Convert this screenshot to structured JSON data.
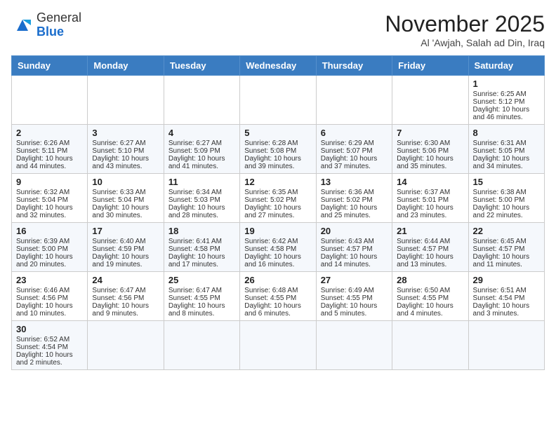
{
  "header": {
    "logo_line1": "General",
    "logo_line2": "Blue",
    "month_title": "November 2025",
    "location": "Al 'Awjah, Salah ad Din, Iraq"
  },
  "weekdays": [
    "Sunday",
    "Monday",
    "Tuesday",
    "Wednesday",
    "Thursday",
    "Friday",
    "Saturday"
  ],
  "weeks": [
    [
      {
        "day": "",
        "info": ""
      },
      {
        "day": "",
        "info": ""
      },
      {
        "day": "",
        "info": ""
      },
      {
        "day": "",
        "info": ""
      },
      {
        "day": "",
        "info": ""
      },
      {
        "day": "",
        "info": ""
      },
      {
        "day": "1",
        "info": "Sunrise: 6:25 AM\nSunset: 5:12 PM\nDaylight: 10 hours and 46 minutes."
      }
    ],
    [
      {
        "day": "2",
        "info": "Sunrise: 6:26 AM\nSunset: 5:11 PM\nDaylight: 10 hours and 44 minutes."
      },
      {
        "day": "3",
        "info": "Sunrise: 6:27 AM\nSunset: 5:10 PM\nDaylight: 10 hours and 43 minutes."
      },
      {
        "day": "4",
        "info": "Sunrise: 6:27 AM\nSunset: 5:09 PM\nDaylight: 10 hours and 41 minutes."
      },
      {
        "day": "5",
        "info": "Sunrise: 6:28 AM\nSunset: 5:08 PM\nDaylight: 10 hours and 39 minutes."
      },
      {
        "day": "6",
        "info": "Sunrise: 6:29 AM\nSunset: 5:07 PM\nDaylight: 10 hours and 37 minutes."
      },
      {
        "day": "7",
        "info": "Sunrise: 6:30 AM\nSunset: 5:06 PM\nDaylight: 10 hours and 35 minutes."
      },
      {
        "day": "8",
        "info": "Sunrise: 6:31 AM\nSunset: 5:05 PM\nDaylight: 10 hours and 34 minutes."
      }
    ],
    [
      {
        "day": "9",
        "info": "Sunrise: 6:32 AM\nSunset: 5:04 PM\nDaylight: 10 hours and 32 minutes."
      },
      {
        "day": "10",
        "info": "Sunrise: 6:33 AM\nSunset: 5:04 PM\nDaylight: 10 hours and 30 minutes."
      },
      {
        "day": "11",
        "info": "Sunrise: 6:34 AM\nSunset: 5:03 PM\nDaylight: 10 hours and 28 minutes."
      },
      {
        "day": "12",
        "info": "Sunrise: 6:35 AM\nSunset: 5:02 PM\nDaylight: 10 hours and 27 minutes."
      },
      {
        "day": "13",
        "info": "Sunrise: 6:36 AM\nSunset: 5:02 PM\nDaylight: 10 hours and 25 minutes."
      },
      {
        "day": "14",
        "info": "Sunrise: 6:37 AM\nSunset: 5:01 PM\nDaylight: 10 hours and 23 minutes."
      },
      {
        "day": "15",
        "info": "Sunrise: 6:38 AM\nSunset: 5:00 PM\nDaylight: 10 hours and 22 minutes."
      }
    ],
    [
      {
        "day": "16",
        "info": "Sunrise: 6:39 AM\nSunset: 5:00 PM\nDaylight: 10 hours and 20 minutes."
      },
      {
        "day": "17",
        "info": "Sunrise: 6:40 AM\nSunset: 4:59 PM\nDaylight: 10 hours and 19 minutes."
      },
      {
        "day": "18",
        "info": "Sunrise: 6:41 AM\nSunset: 4:58 PM\nDaylight: 10 hours and 17 minutes."
      },
      {
        "day": "19",
        "info": "Sunrise: 6:42 AM\nSunset: 4:58 PM\nDaylight: 10 hours and 16 minutes."
      },
      {
        "day": "20",
        "info": "Sunrise: 6:43 AM\nSunset: 4:57 PM\nDaylight: 10 hours and 14 minutes."
      },
      {
        "day": "21",
        "info": "Sunrise: 6:44 AM\nSunset: 4:57 PM\nDaylight: 10 hours and 13 minutes."
      },
      {
        "day": "22",
        "info": "Sunrise: 6:45 AM\nSunset: 4:57 PM\nDaylight: 10 hours and 11 minutes."
      }
    ],
    [
      {
        "day": "23",
        "info": "Sunrise: 6:46 AM\nSunset: 4:56 PM\nDaylight: 10 hours and 10 minutes."
      },
      {
        "day": "24",
        "info": "Sunrise: 6:47 AM\nSunset: 4:56 PM\nDaylight: 10 hours and 9 minutes."
      },
      {
        "day": "25",
        "info": "Sunrise: 6:47 AM\nSunset: 4:55 PM\nDaylight: 10 hours and 8 minutes."
      },
      {
        "day": "26",
        "info": "Sunrise: 6:48 AM\nSunset: 4:55 PM\nDaylight: 10 hours and 6 minutes."
      },
      {
        "day": "27",
        "info": "Sunrise: 6:49 AM\nSunset: 4:55 PM\nDaylight: 10 hours and 5 minutes."
      },
      {
        "day": "28",
        "info": "Sunrise: 6:50 AM\nSunset: 4:55 PM\nDaylight: 10 hours and 4 minutes."
      },
      {
        "day": "29",
        "info": "Sunrise: 6:51 AM\nSunset: 4:54 PM\nDaylight: 10 hours and 3 minutes."
      }
    ],
    [
      {
        "day": "30",
        "info": "Sunrise: 6:52 AM\nSunset: 4:54 PM\nDaylight: 10 hours and 2 minutes."
      },
      {
        "day": "",
        "info": ""
      },
      {
        "day": "",
        "info": ""
      },
      {
        "day": "",
        "info": ""
      },
      {
        "day": "",
        "info": ""
      },
      {
        "day": "",
        "info": ""
      },
      {
        "day": "",
        "info": ""
      }
    ]
  ]
}
